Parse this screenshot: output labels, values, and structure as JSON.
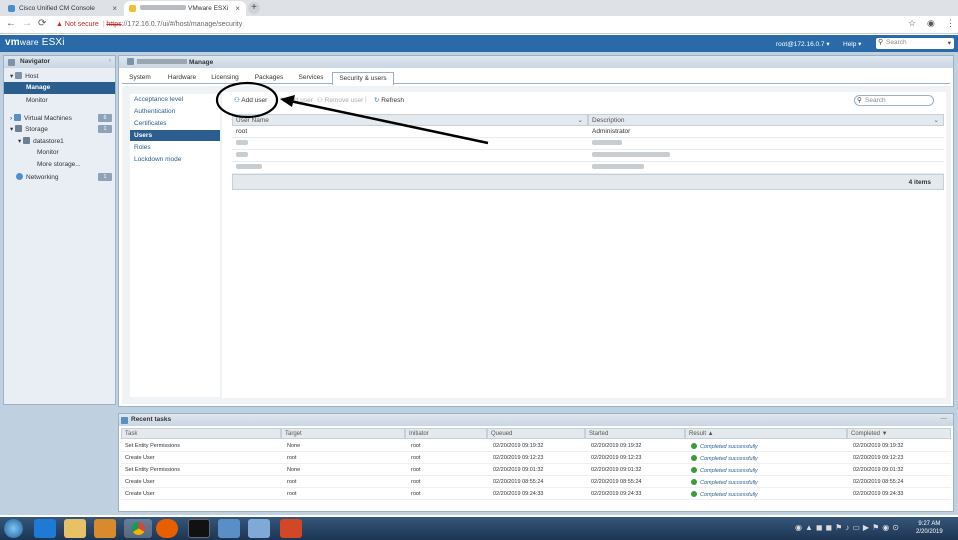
{
  "browser": {
    "tabs": [
      {
        "title": "Cisco Unified CM Console",
        "close": "×"
      },
      {
        "title": "VMware ESXi",
        "close": "×"
      }
    ],
    "new_tab": "+",
    "back": "←",
    "forward": "→",
    "reload": "⟳",
    "url_warning": "▲ Not secure",
    "url_scheme": "https",
    "url_rest": "://172.16.0.7/ui/#/host/manage/security",
    "star": "☆",
    "account": "◉",
    "menu": "⋮"
  },
  "header": {
    "logo_bold": "vm",
    "logo_rest": "ware",
    "logo_product": " ESXi",
    "user": "root@172.16.0.7 ▾",
    "help": "Help ▾",
    "search_placeholder": "Search"
  },
  "navigator": {
    "title": "Navigator",
    "items": [
      {
        "label": "Host",
        "badge": ""
      },
      {
        "label": "Manage",
        "badge": ""
      },
      {
        "label": "Monitor",
        "badge": ""
      },
      {
        "label": "Virtual Machines",
        "badge": "6"
      },
      {
        "label": "Storage",
        "badge": "1"
      },
      {
        "label": "datastore1",
        "badge": ""
      },
      {
        "label": "Monitor",
        "badge": ""
      },
      {
        "label": "More storage...",
        "badge": ""
      },
      {
        "label": "Networking",
        "badge": "1"
      }
    ]
  },
  "manage": {
    "title": "Manage",
    "tabs": [
      "System",
      "Hardware",
      "Licensing",
      "Packages",
      "Services",
      "Security & users"
    ],
    "left_menu": [
      "Acceptance level",
      "Authentication",
      "Certificates",
      "Users",
      "Roles",
      "Lockdown mode"
    ],
    "toolbar": {
      "add_user": "Add user",
      "edit_user": "Edit user",
      "remove_user": "Remove user",
      "refresh": "Refresh",
      "search_placeholder": "Search"
    },
    "users_table": {
      "columns": [
        "User Name",
        "Description"
      ],
      "rows": [
        {
          "name": "root",
          "description": "Administrator"
        }
      ],
      "count": "4 items"
    }
  },
  "recent_tasks": {
    "title": "Recent tasks",
    "columns": [
      "Task",
      "Target",
      "Initiator",
      "Queued",
      "Started",
      "Result ▲",
      "Completed ▼"
    ],
    "rows": [
      {
        "task": "Set Entity Permissions",
        "target": "None",
        "initiator": "root",
        "queued": "02/20/2019 09:19:32",
        "started": "02/20/2019 09:19:32",
        "result": "Completed successfully",
        "completed": "02/20/2019 09:19:32"
      },
      {
        "task": "Create User",
        "target": "root",
        "initiator": "root",
        "queued": "02/20/2019 09:12:23",
        "started": "02/20/2019 09:12:23",
        "result": "Completed successfully",
        "completed": "02/20/2019 09:12:23"
      },
      {
        "task": "Set Entity Permissions",
        "target": "None",
        "initiator": "root",
        "queued": "02/20/2019 09:01:32",
        "started": "02/20/2019 09:01:32",
        "result": "Completed successfully",
        "completed": "02/20/2019 09:01:32"
      },
      {
        "task": "Create User",
        "target": "root",
        "initiator": "root",
        "queued": "02/20/2019 08:55:24",
        "started": "02/20/2019 08:55:24",
        "result": "Completed successfully",
        "completed": "02/20/2019 08:55:24"
      },
      {
        "task": "Create User",
        "target": "root",
        "initiator": "root",
        "queued": "02/20/2019 09:24:33",
        "started": "02/20/2019 09:24:33",
        "result": "Completed successfully",
        "completed": "02/20/2019 09:24:33"
      }
    ]
  },
  "taskbar": {
    "time": "9:27 AM",
    "date": "2/20/2019",
    "apps": [
      "start-orb",
      "internet-explorer",
      "file-explorer",
      "media-player",
      "chrome",
      "firefox",
      "command-prompt",
      "network-tool",
      "remote-desktop",
      "powerpoint"
    ]
  },
  "colors": {
    "vmware_blue": "#2a6aa9",
    "selection": "#2b5e8f",
    "success": "#3a9b3a"
  }
}
